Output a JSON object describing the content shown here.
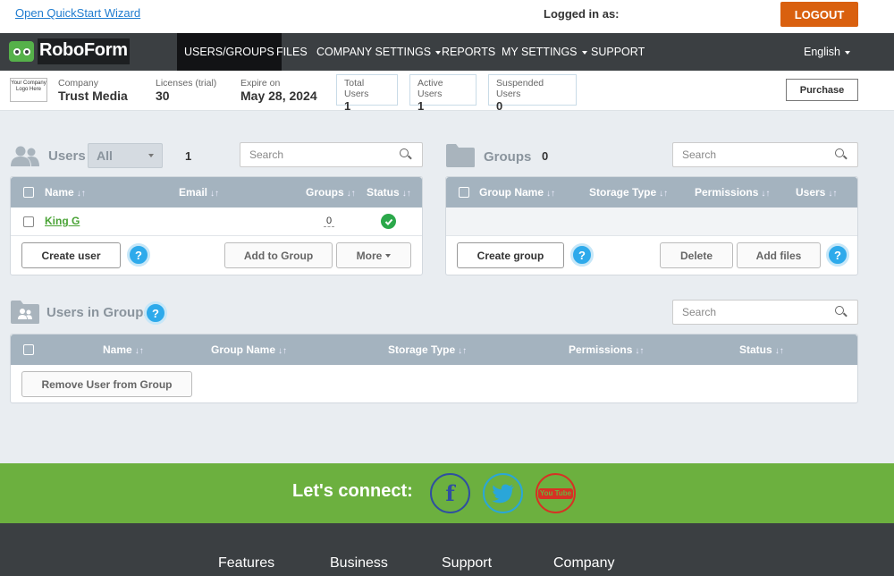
{
  "topbar": {
    "quickstart": "Open QuickStart Wizard",
    "logged_in_label": "Logged in as:",
    "logout": "LOGOUT"
  },
  "nav": {
    "logo": "RoboForm",
    "items": [
      {
        "label": "USERS/GROUPS",
        "active": true
      },
      {
        "label": "FILES"
      },
      {
        "label": "COMPANY SETTINGS"
      },
      {
        "label": "REPORTS"
      },
      {
        "label": "MY SETTINGS"
      },
      {
        "label": "SUPPORT"
      }
    ],
    "language": "English"
  },
  "info": {
    "company_logo": "Your Company Logo Here",
    "company_label": "Company",
    "company": "Trust Media",
    "licenses_label": "Licenses (trial)",
    "licenses": "30",
    "expire_label": "Expire on",
    "expire": "May 28, 2024",
    "total_users_label": "Total Users",
    "total_users": "1",
    "active_users_label": "Active Users",
    "active_users": "1",
    "suspended_users_label": "Suspended Users",
    "suspended_users": "0",
    "purchase": "Purchase"
  },
  "users": {
    "title": "Users",
    "filter": "All",
    "count": "1",
    "search_placeholder": "Search",
    "columns": [
      "Name",
      "Email",
      "Groups",
      "Status"
    ],
    "rows": [
      {
        "name": "King G",
        "email": "",
        "groups": "0",
        "status": "active"
      }
    ],
    "create": "Create user",
    "add_to_group": "Add to Group",
    "more": "More",
    "help": "?"
  },
  "groups": {
    "title": "Groups",
    "count": "0",
    "search_placeholder": "Search",
    "columns": [
      "Group Name",
      "Storage Type",
      "Permissions",
      "Users"
    ],
    "create": "Create group",
    "delete": "Delete",
    "add_files": "Add files",
    "help": "?"
  },
  "users_in_groups": {
    "title": "Users in Groups",
    "search_placeholder": "Search",
    "columns": [
      "Name",
      "Group Name",
      "Storage Type",
      "Permissions",
      "Status"
    ],
    "remove": "Remove User from Group",
    "help": "?"
  },
  "connect": {
    "text": "Let's connect:",
    "networks": [
      {
        "name": "facebook",
        "glyph": "f",
        "color": "#2f4fa0"
      },
      {
        "name": "twitter",
        "glyph": "t",
        "color": "#2aa6d8"
      },
      {
        "name": "youtube",
        "glyph": "You Tube",
        "color": "#d63224"
      }
    ]
  },
  "footer": {
    "links": [
      "Features",
      "Business",
      "Support",
      "Company"
    ]
  }
}
